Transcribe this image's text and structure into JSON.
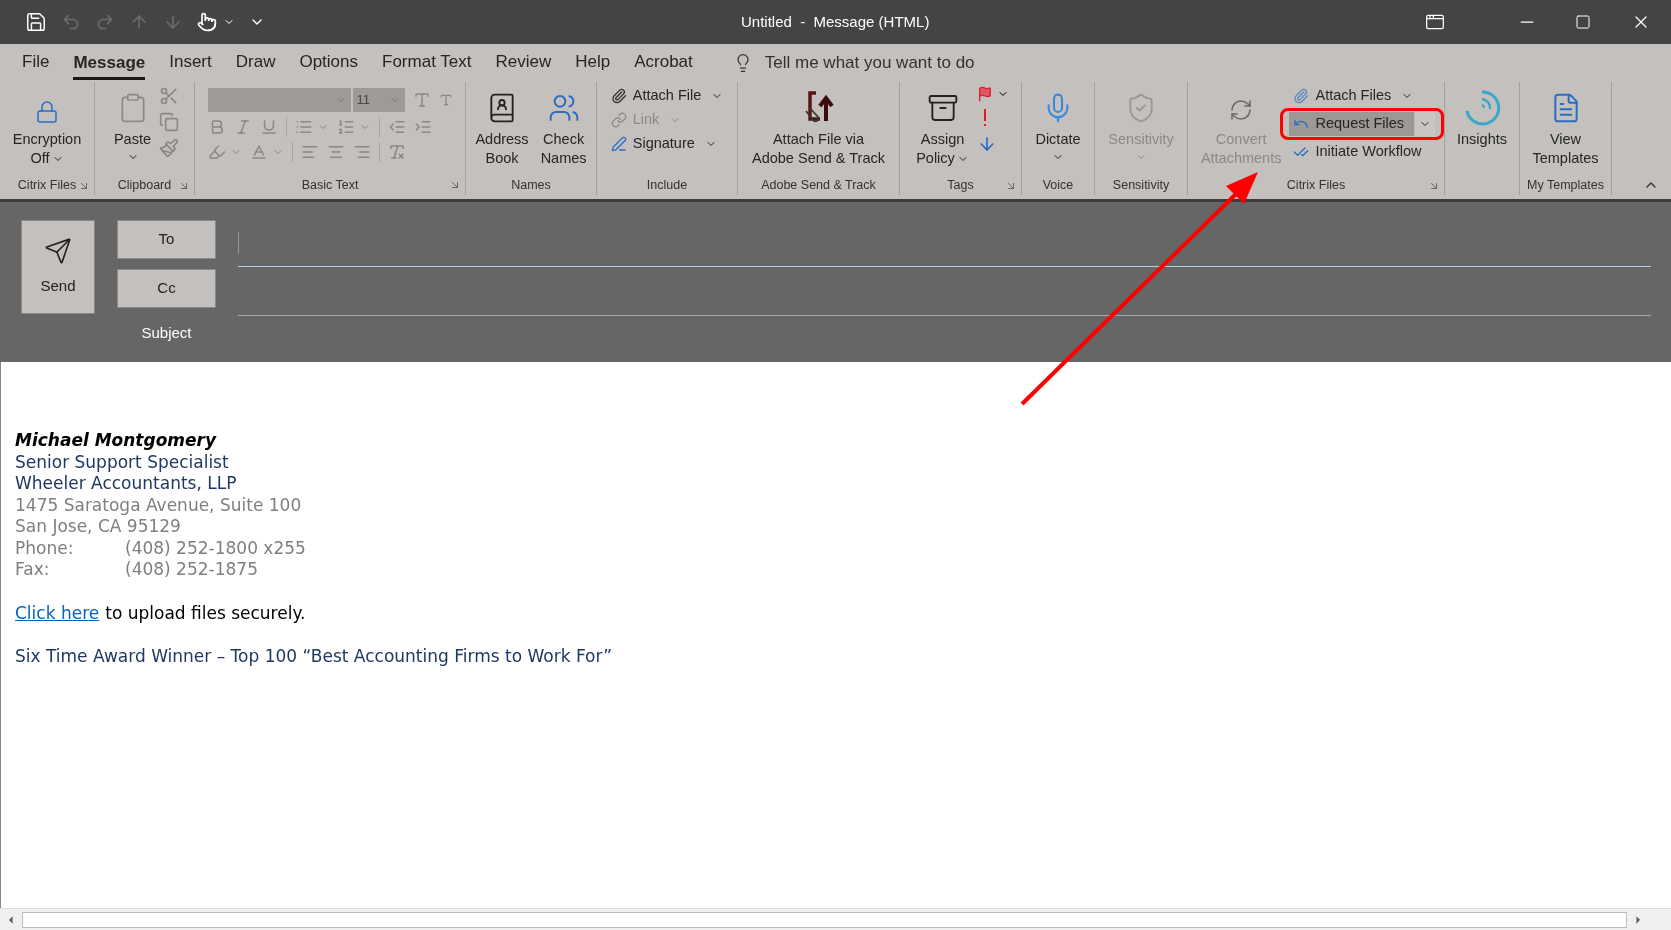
{
  "title_bar": {
    "title": "Untitled  -  Message (HTML)"
  },
  "tabs": [
    {
      "label": "File",
      "selected": false
    },
    {
      "label": "Message",
      "selected": true
    },
    {
      "label": "Insert",
      "selected": false
    },
    {
      "label": "Draw",
      "selected": false
    },
    {
      "label": "Options",
      "selected": false
    },
    {
      "label": "Format Text",
      "selected": false
    },
    {
      "label": "Review",
      "selected": false
    },
    {
      "label": "Help",
      "selected": false
    },
    {
      "label": "Acrobat",
      "selected": false
    }
  ],
  "tell_me": {
    "placeholder": "Tell me what you want to do"
  },
  "ribbon": {
    "groups": [
      {
        "kind": "buttons",
        "label": "Citrix Files",
        "items": [
          {
            "kind": "large",
            "lines": [
              "Encryption",
              "Off"
            ],
            "disabled": false
          }
        ]
      },
      {
        "kind": "buttons",
        "label": "Clipboard",
        "items": [
          {
            "kind": "large",
            "lines": [
              "Paste"
            ],
            "disabled": false
          }
        ]
      },
      {
        "kind": "basic-text",
        "label": "Basic Text",
        "font_size": "11"
      },
      {
        "kind": "buttons",
        "label": "Names",
        "items": [
          {
            "kind": "large",
            "lines": [
              "Address",
              "Book"
            ],
            "disabled": false
          },
          {
            "kind": "large",
            "lines": [
              "Check",
              "Names"
            ],
            "disabled": false
          }
        ]
      },
      {
        "kind": "buttons",
        "label": "Include",
        "items": [
          {
            "kind": "small",
            "label": "Attach File",
            "disabled": false
          },
          {
            "kind": "small",
            "label": "Link",
            "disabled": true
          },
          {
            "kind": "small",
            "label": "Signature",
            "disabled": false
          }
        ]
      },
      {
        "kind": "buttons",
        "label": "Adobe Send & Track",
        "items": [
          {
            "kind": "large",
            "lines": [
              "Attach File via",
              "Adobe Send & Track"
            ],
            "disabled": false
          }
        ]
      },
      {
        "kind": "buttons",
        "label": "Tags",
        "items": [
          {
            "kind": "large",
            "lines": [
              "Assign",
              "Policy"
            ],
            "disabled": false
          }
        ]
      },
      {
        "kind": "buttons",
        "label": "Voice",
        "items": [
          {
            "kind": "large",
            "lines": [
              "Dictate"
            ],
            "disabled": false
          }
        ]
      },
      {
        "kind": "buttons",
        "label": "Sensitivity",
        "items": [
          {
            "kind": "large",
            "lines": [
              "Sensitivity"
            ],
            "disabled": true
          }
        ]
      },
      {
        "kind": "buttons",
        "label": "Citrix Files",
        "items": [
          {
            "kind": "large",
            "lines": [
              "Convert",
              "Attachments"
            ],
            "disabled": true
          },
          {
            "kind": "small",
            "label": "Attach Files",
            "disabled": false,
            "selected": false,
            "highlighted": false
          },
          {
            "kind": "small",
            "label": "Request Files",
            "disabled": false,
            "selected": true,
            "highlighted": true
          },
          {
            "kind": "small",
            "label": "Initiate Workflow",
            "disabled": false,
            "selected": false,
            "highlighted": false
          }
        ]
      },
      {
        "kind": "buttons",
        "items": [
          {
            "kind": "large",
            "lines": [
              "Insights"
            ],
            "disabled": false
          }
        ]
      },
      {
        "kind": "buttons",
        "label": "My Templates",
        "items": [
          {
            "kind": "large",
            "lines": [
              "View",
              "Templates"
            ],
            "disabled": false
          }
        ]
      }
    ]
  },
  "callout_arrow": true,
  "compose": {
    "send": "Send",
    "to": "To",
    "cc": "Cc",
    "subject": "Subject"
  },
  "body": [
    {
      "kind": "name",
      "text": "Michael Montgomery"
    },
    {
      "kind": "title",
      "text": "Senior Support Specialist"
    },
    {
      "kind": "title",
      "text": "Wheeler Accountants, LLP"
    },
    {
      "kind": "address",
      "text": "1475 Saratoga Avenue, Suite 100"
    },
    {
      "kind": "address",
      "text": "San Jose, CA 95129"
    },
    {
      "kind": "contact",
      "label": "Phone:",
      "text": "(408) 252-1800 x255"
    },
    {
      "kind": "contact",
      "label": "Fax:",
      "text": "(408) 252-1875"
    },
    {
      "kind": "link-line",
      "link": "Click here",
      "text": "to upload files securely."
    },
    {
      "kind": "award",
      "text": "Six Time Award Winner – Top 100 “Best Accounting Firms to Work For”"
    }
  ]
}
